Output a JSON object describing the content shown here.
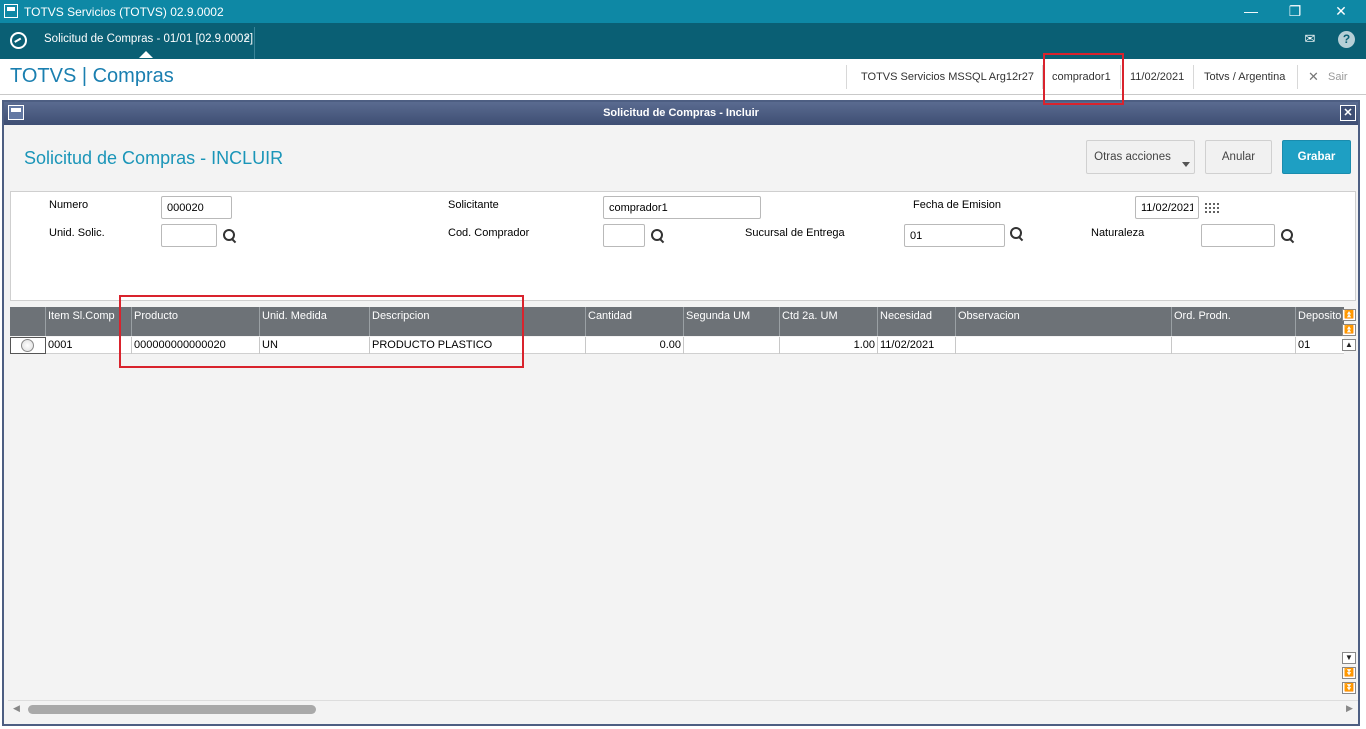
{
  "window": {
    "title": "TOTVS Servicios (TOTVS) 02.9.0002",
    "minimize": "—",
    "restore": "❐",
    "close": "✕"
  },
  "tabbar": {
    "tab_label": "Solicitud de Compras - 01/01 [02.9.0002]",
    "tab_close": "×",
    "mail_icon": "✉",
    "help_icon": "?"
  },
  "header": {
    "brand": "TOTVS | Compras",
    "environment": "TOTVS Servicios MSSQL Arg12r27",
    "user": "comprador1",
    "date": "11/02/2021",
    "company": "Totvs / Argentina",
    "exit_label": "Sair",
    "exit_icon": "✕"
  },
  "dialog": {
    "title": "Solicitud de Compras - Incluir",
    "close": "✕",
    "form_title": "Solicitud de Compras - INCLUIR",
    "buttons": {
      "other_actions": "Otras acciones",
      "cancel": "Anular",
      "save": "Grabar"
    }
  },
  "form": {
    "numero_label": "Numero",
    "numero_value": "000020",
    "solicitante_label": "Solicitante",
    "solicitante_value": "comprador1",
    "fecha_label": "Fecha de Emision",
    "fecha_value": "11/02/2021",
    "unid_solic_label": "Unid. Solic.",
    "unid_solic_value": "",
    "cod_comprador_label": "Cod. Comprador",
    "cod_comprador_value": "",
    "sucursal_label": "Sucursal de Entrega",
    "sucursal_value": "01",
    "naturaleza_label": "Naturaleza",
    "naturaleza_value": ""
  },
  "grid": {
    "columns": [
      "Item Sl.Comp",
      "Producto",
      "Unid. Medida",
      "Descripcion",
      "Cantidad",
      "Segunda UM",
      "Ctd 2a. UM",
      "Necesidad",
      "Observacion",
      "Ord. Prodn.",
      "Deposito"
    ],
    "rows": [
      {
        "item": "0001",
        "producto": "000000000000020",
        "unid_medida": "UN",
        "descripcion": "PRODUCTO PLASTICO",
        "cantidad": "0.00",
        "segunda_um": "",
        "ctd_2a_um": "1.00",
        "necesidad": "11/02/2021",
        "observacion": "",
        "ord_prodn": "",
        "deposito": "01"
      }
    ]
  },
  "colors": {
    "titlebar": "#0e88a5",
    "tabbar": "#0a5f74",
    "brand": "#1a7fb0",
    "primary_button": "#1e9fc3",
    "grid_header": "#6d7277",
    "highlight": "#d9232d"
  }
}
